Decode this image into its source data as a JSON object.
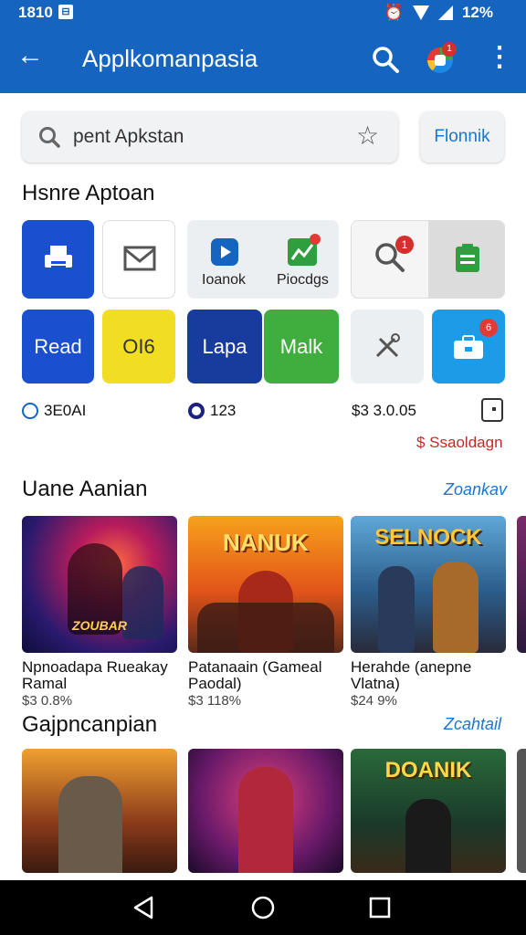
{
  "status_bar": {
    "time": "1810",
    "battery": "12%",
    "badge": "⊟"
  },
  "app_bar": {
    "title": "Applkomanpasia",
    "notification_count": "1"
  },
  "search": {
    "value": "pent Apkstan",
    "filter_label": "Flonnik"
  },
  "quick_actions": {
    "title": "Hsnre Aptoan",
    "tiles": [
      {
        "label": "",
        "icon": "printer-icon"
      },
      {
        "label": "",
        "icon": "mail-icon"
      },
      {
        "label": "Ioanok",
        "icon": "play-icon"
      },
      {
        "label": "Piocdgs",
        "icon": "chart-icon"
      },
      {
        "label": "",
        "icon": "search-icon",
        "badge": "1"
      },
      {
        "label": "",
        "icon": "clipboard-icon"
      },
      {
        "label": "Read"
      },
      {
        "label": "OI6"
      },
      {
        "label": "Lapa"
      },
      {
        "label": "Malk"
      },
      {
        "label": "",
        "icon": "tools-icon"
      },
      {
        "label": "",
        "icon": "toolbox-icon",
        "badge": "6"
      }
    ],
    "stats": [
      "3E0AI",
      "123",
      "$3 3.0.05"
    ],
    "sale_link": "$ Ssaoldagn"
  },
  "section1": {
    "title": "Uane Aanian",
    "see_all": "Zoankav",
    "items": [
      {
        "name": "Npnoadapa Rueakay Ramal",
        "price": "$3 0.8%",
        "art_label": "ZOUBAR"
      },
      {
        "name": "Patanaain (Gameal Paodal)",
        "price": "$3 118%",
        "art_label": "NANUK"
      },
      {
        "name": "Herahde (anepne Vlatna)",
        "price": "$24 9%",
        "art_label": "SELNOCK"
      }
    ]
  },
  "section2": {
    "title": "Gajpncanpian",
    "see_all": "Zcahtail",
    "items": [
      {
        "art_label": ""
      },
      {
        "art_label": ""
      },
      {
        "art_label": "DOANIK"
      }
    ]
  },
  "colors": {
    "primary": "#1565c0",
    "accent": "#1976d2",
    "sale": "#c62828"
  }
}
